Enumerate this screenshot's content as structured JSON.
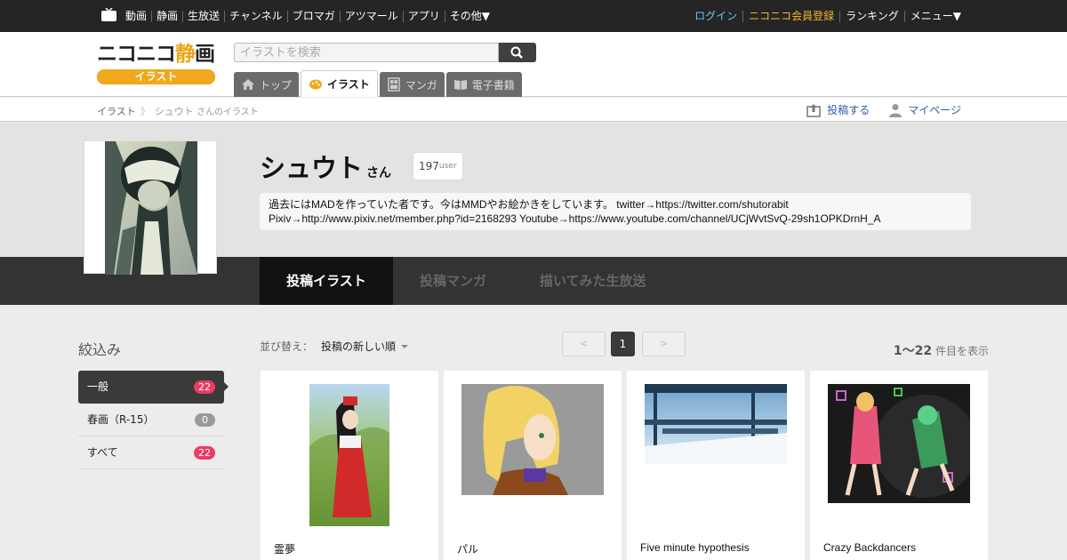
{
  "topnav": {
    "items": [
      "動画",
      "静画",
      "生放送",
      "チャンネル",
      "ブロマガ",
      "アツマール",
      "アプリ",
      "その他▼"
    ],
    "login": "ログイン",
    "register": "ニコニコ会員登録",
    "ranking": "ランキング",
    "menu": "メニュー▼"
  },
  "header": {
    "logo_main_a": "ニコニコ",
    "logo_main_b": "静",
    "logo_main_c": "画",
    "logo_sub": "イラスト",
    "search_placeholder": "イラストを検索",
    "tabs": [
      {
        "label": "トップ"
      },
      {
        "label": "イラスト"
      },
      {
        "label": "マンガ"
      },
      {
        "label": "電子書籍"
      }
    ]
  },
  "breadcrumb": {
    "root": "イラスト",
    "separator": "》",
    "user": "シュウト",
    "suffix": "さんのイラスト",
    "post": "投稿する",
    "mypage": "マイページ"
  },
  "profile": {
    "name": "シュウト",
    "honorific": "さん",
    "badge_number": "197",
    "badge_unit": "user",
    "desc_line1": "過去にはMADを作っていた者です。今はMMDやお絵かきをしています。 twitter→https://twitter.com/shutorabit",
    "desc_line2": "Pixiv→http://www.pixiv.net/member.php?id=2168293 Youtube→https://www.youtube.com/channel/UCjWvtSvQ-29sh1OPKDrnH_A"
  },
  "profile_tabs": [
    "投稿イラスト",
    "投稿マンガ",
    "描いてみた生放送"
  ],
  "filter": {
    "title": "絞込み",
    "items": [
      {
        "label": "一般",
        "count": "22"
      },
      {
        "label": "春画（R-15）",
        "count": "0"
      },
      {
        "label": "すべて",
        "count": "22"
      }
    ]
  },
  "sort": {
    "label": "並び替え：",
    "value": "投稿の新しい順"
  },
  "pager": {
    "prev": "<",
    "current": "1",
    "next": ">"
  },
  "results": {
    "range": "1〜22",
    "suffix": "件目を表示"
  },
  "illustrations": [
    {
      "title": "霊夢"
    },
    {
      "title": "パル"
    },
    {
      "title": "Five minute hypothesis"
    },
    {
      "title": "Crazy Backdancers"
    }
  ],
  "colors": {
    "topbar": "#252525",
    "accent_orange": "#f0a81c",
    "count_badge": "#e83d64",
    "link_blue": "#2c5da9"
  }
}
